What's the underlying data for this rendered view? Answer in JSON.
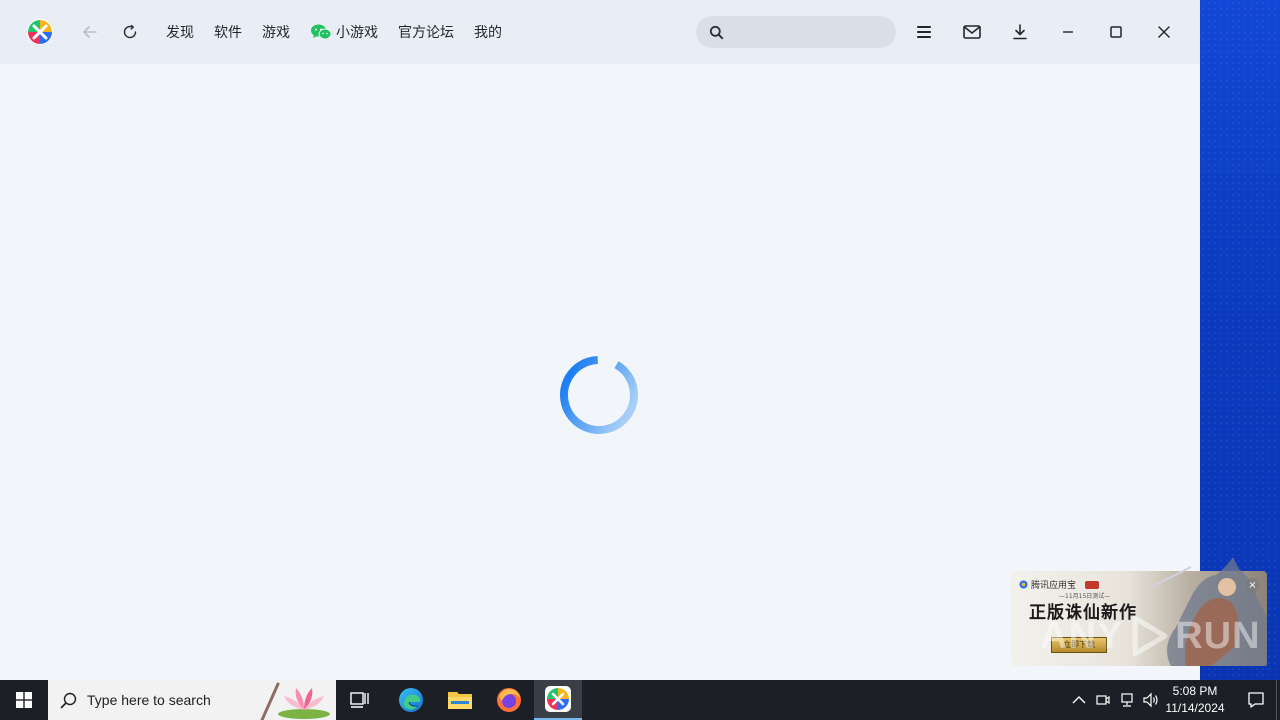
{
  "nav": {
    "tabs": [
      {
        "label": "发现"
      },
      {
        "label": "软件"
      },
      {
        "label": "游戏"
      },
      {
        "label": "小游戏",
        "icon": "wechat-icon"
      },
      {
        "label": "官方论坛"
      },
      {
        "label": "我的"
      }
    ]
  },
  "search": {
    "placeholder": "",
    "value": ""
  },
  "content": {
    "state": "loading"
  },
  "ad": {
    "brand": "腾讯应用宝",
    "date": "—11月15日测试—",
    "headline": "正版诛仙新作",
    "cta": "立即下载",
    "close": "×"
  },
  "watermark": {
    "left": "ANY",
    "right": "RUN"
  },
  "taskbar": {
    "search_placeholder": "Type here to search",
    "time": "5:08 PM",
    "date": "11/14/2024"
  },
  "colors": {
    "accent": "#1e7ff0",
    "titlebar": "#e9eef6",
    "content_bg": "#f2f5fa",
    "desktop": "#0a3fc4",
    "taskbar": "#1c2026"
  }
}
